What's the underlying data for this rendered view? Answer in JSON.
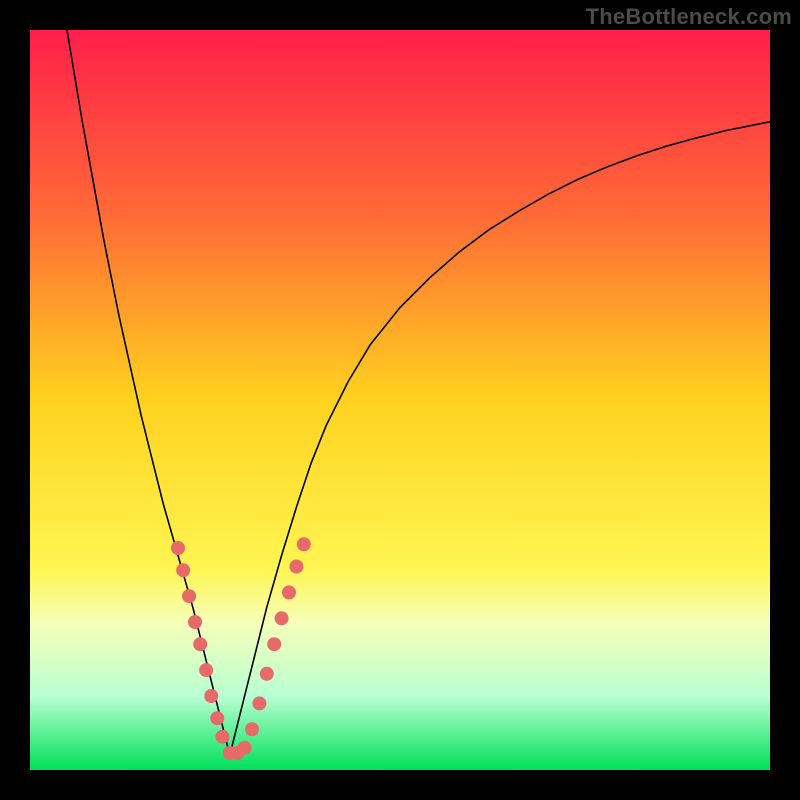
{
  "watermark": "TheBottleneck.com",
  "chart_data": {
    "type": "line",
    "title": "",
    "xlabel": "",
    "ylabel": "",
    "xlim": [
      0,
      100
    ],
    "ylim": [
      0,
      100
    ],
    "grid": false,
    "legend": false,
    "background_gradient": {
      "stops": [
        {
          "offset": 0.0,
          "color": "#ff1f4b"
        },
        {
          "offset": 0.25,
          "color": "#ff6a36"
        },
        {
          "offset": 0.5,
          "color": "#ffd21f"
        },
        {
          "offset": 0.73,
          "color": "#fff553"
        },
        {
          "offset": 0.8,
          "color": "#f6ffb9"
        },
        {
          "offset": 0.9,
          "color": "#b9ffd2"
        },
        {
          "offset": 1.0,
          "color": "#00e05a"
        }
      ]
    },
    "series": [
      {
        "name": "left-curve",
        "color": "#000000",
        "width": 1.6,
        "x": [
          5,
          6,
          7,
          8,
          9,
          10,
          11,
          12,
          13,
          14,
          15,
          16,
          17,
          18,
          19,
          20,
          21,
          22,
          23,
          24,
          25,
          26,
          27
        ],
        "y": [
          100,
          94,
          88,
          82.5,
          77,
          71.5,
          66.5,
          61.5,
          57,
          52.5,
          48,
          44,
          40,
          36,
          32.5,
          29,
          25.5,
          22,
          18,
          14,
          10,
          6,
          2
        ]
      },
      {
        "name": "right-curve",
        "color": "#000000",
        "width": 1.6,
        "x": [
          27,
          28,
          30,
          32,
          34,
          36,
          38,
          40,
          43,
          46,
          50,
          54,
          58,
          62,
          66,
          70,
          74,
          78,
          82,
          86,
          90,
          94,
          98,
          100
        ],
        "y": [
          2,
          6,
          14,
          22,
          29,
          35.5,
          41.5,
          46.5,
          52.5,
          57.5,
          62.5,
          66.5,
          70,
          73,
          75.5,
          77.8,
          79.8,
          81.5,
          83,
          84.3,
          85.4,
          86.4,
          87.2,
          87.6
        ]
      }
    ],
    "markers": {
      "name": "highlight-dots",
      "color": "#e76a6a",
      "radius": 7,
      "points": [
        {
          "x": 20.0,
          "y": 30.0
        },
        {
          "x": 20.7,
          "y": 27.0
        },
        {
          "x": 21.5,
          "y": 23.5
        },
        {
          "x": 22.3,
          "y": 20.0
        },
        {
          "x": 23.0,
          "y": 17.0
        },
        {
          "x": 23.8,
          "y": 13.5
        },
        {
          "x": 24.5,
          "y": 10.0
        },
        {
          "x": 25.3,
          "y": 7.0
        },
        {
          "x": 26.0,
          "y": 4.5
        },
        {
          "x": 27.0,
          "y": 2.3
        },
        {
          "x": 28.0,
          "y": 2.3
        },
        {
          "x": 29.0,
          "y": 3.0
        },
        {
          "x": 30.0,
          "y": 5.5
        },
        {
          "x": 31.0,
          "y": 9.0
        },
        {
          "x": 32.0,
          "y": 13.0
        },
        {
          "x": 33.0,
          "y": 17.0
        },
        {
          "x": 34.0,
          "y": 20.5
        },
        {
          "x": 35.0,
          "y": 24.0
        },
        {
          "x": 36.0,
          "y": 27.5
        },
        {
          "x": 37.0,
          "y": 30.5
        }
      ]
    }
  }
}
